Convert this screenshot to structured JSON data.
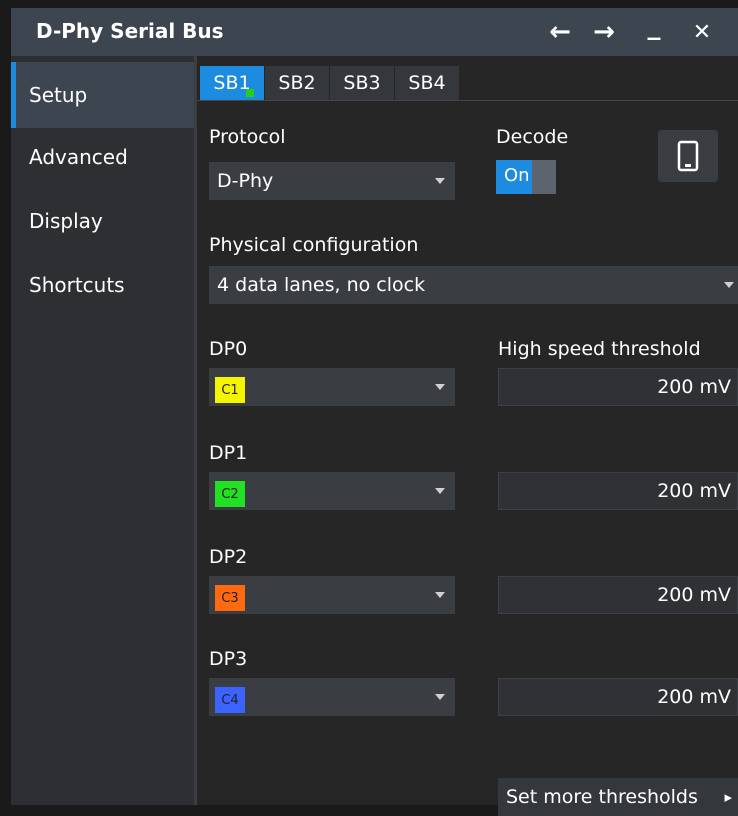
{
  "window": {
    "title": "D-Phy Serial Bus",
    "back_icon": "←",
    "forward_icon": "→",
    "minimize_icon": "_",
    "close_icon": "✕"
  },
  "sidebar": {
    "items": [
      {
        "label": "Setup",
        "active": true
      },
      {
        "label": "Advanced"
      },
      {
        "label": "Display"
      },
      {
        "label": "Shortcuts"
      }
    ]
  },
  "tabs": [
    {
      "label": "SB1",
      "active": true
    },
    {
      "label": "SB2"
    },
    {
      "label": "SB3"
    },
    {
      "label": "SB4"
    }
  ],
  "protocol": {
    "label": "Protocol",
    "value": "D-Phy"
  },
  "decode": {
    "label": "Decode",
    "value": "On"
  },
  "physical_config": {
    "label": "Physical configuration",
    "value": "4 data lanes, no clock"
  },
  "threshold_header": "High speed threshold",
  "lanes": [
    {
      "label": "DP0",
      "channel": "C1",
      "channel_color": "#f5f500",
      "threshold": "200 mV"
    },
    {
      "label": "DP1",
      "channel": "C2",
      "channel_color": "#22e022",
      "threshold": "200 mV"
    },
    {
      "label": "DP2",
      "channel": "C3",
      "channel_color": "#ff6a10",
      "threshold": "200 mV"
    },
    {
      "label": "DP3",
      "channel": "C4",
      "channel_color": "#3a63ff",
      "threshold": "200 mV"
    }
  ],
  "more_thresholds": {
    "label": "Set more thresholds",
    "arrow": "▸"
  },
  "colors": {
    "accent": "#1c8be0",
    "title_bar": "#3d4551"
  }
}
